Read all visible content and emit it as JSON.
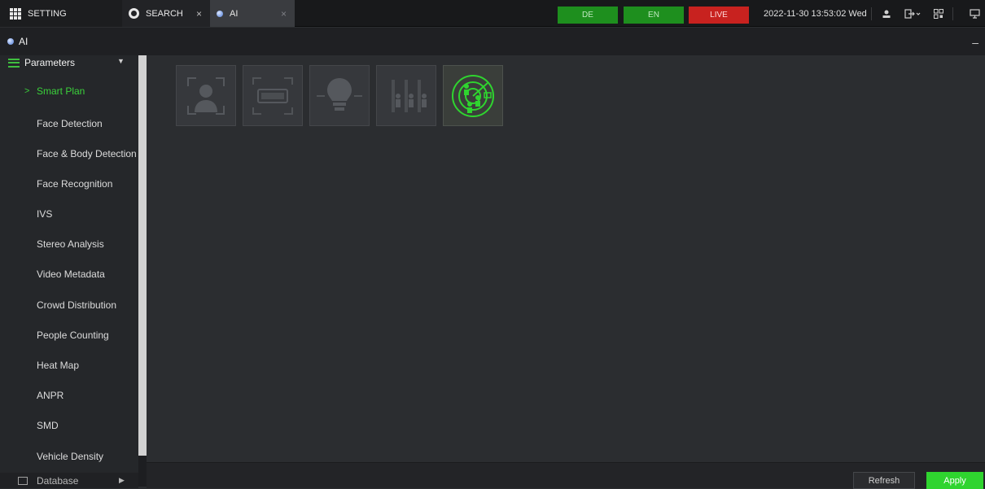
{
  "tabs": [
    {
      "label": "SETTING",
      "icon": "grid-icon"
    },
    {
      "label": "SEARCH",
      "icon": "search-icon",
      "close": "×"
    },
    {
      "label": "AI",
      "icon": "ai-dot-icon",
      "close": "×"
    }
  ],
  "mode_buttons": {
    "de": "DE",
    "en": "EN",
    "live": "LIVE"
  },
  "datetime": "2022-11-30 13:53:02 Wed",
  "titlebar": {
    "title": "AI",
    "minimize": "–"
  },
  "sidebar": {
    "header": "Parameters",
    "items": [
      {
        "label": "Smart Plan",
        "active": true
      },
      {
        "label": "Face Detection"
      },
      {
        "label": "Face & Body Detection"
      },
      {
        "label": "Face Recognition"
      },
      {
        "label": "IVS"
      },
      {
        "label": "Stereo Analysis"
      },
      {
        "label": "Video Metadata"
      },
      {
        "label": "Crowd Distribution"
      },
      {
        "label": "People Counting"
      },
      {
        "label": "Heat Map"
      },
      {
        "label": "ANPR"
      },
      {
        "label": "SMD"
      },
      {
        "label": "Vehicle Density"
      }
    ],
    "footer": "Database"
  },
  "smart_plan_tiles": [
    {
      "name": "face-detection",
      "icon": "face-frame-icon",
      "enabled": false
    },
    {
      "name": "anpr",
      "icon": "license-plate-icon",
      "enabled": false
    },
    {
      "name": "ivs",
      "icon": "light-bulb-icon",
      "enabled": false
    },
    {
      "name": "people-counting",
      "icon": "people-count-icon",
      "enabled": false
    },
    {
      "name": "crowd-distribution",
      "icon": "radar-people-icon",
      "enabled": true
    }
  ],
  "footer": {
    "refresh": "Refresh",
    "apply": "Apply"
  },
  "colors": {
    "accent": "#2fd42f",
    "live": "#c8221f",
    "mode": "#1e8f1e",
    "background": "#2b2d30"
  }
}
